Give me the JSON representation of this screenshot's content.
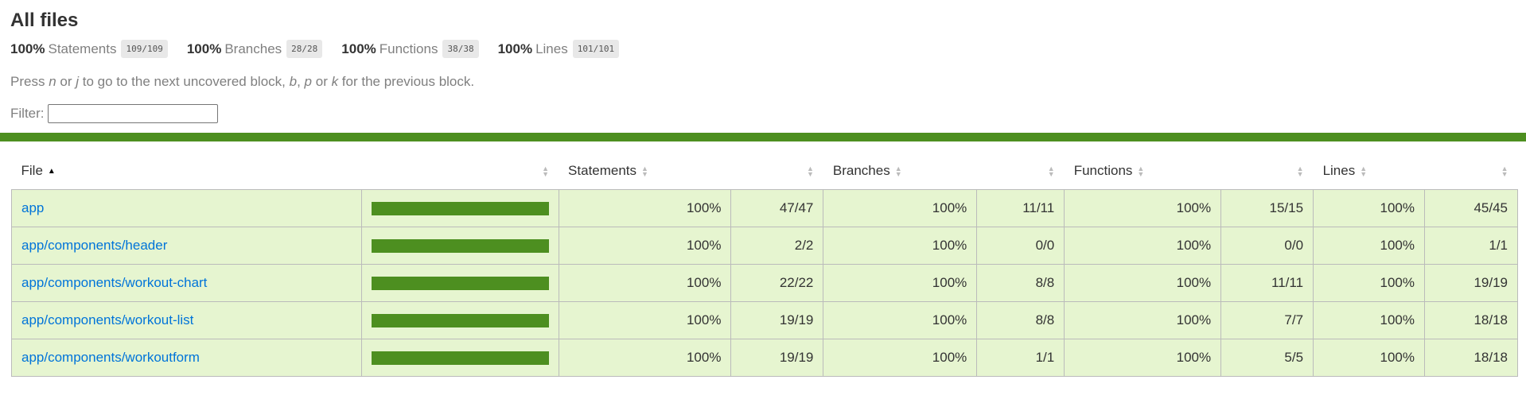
{
  "title": "All files",
  "summary": [
    {
      "pct": "100%",
      "label": "Statements",
      "fraction": "109/109"
    },
    {
      "pct": "100%",
      "label": "Branches",
      "fraction": "28/28"
    },
    {
      "pct": "100%",
      "label": "Functions",
      "fraction": "38/38"
    },
    {
      "pct": "100%",
      "label": "Lines",
      "fraction": "101/101"
    }
  ],
  "help": {
    "t1": "Press ",
    "k1": "n",
    "t2": " or ",
    "k2": "j",
    "t3": " to go to the next uncovered block, ",
    "k3": "b",
    "t4": ", ",
    "k4": "p",
    "t5": " or ",
    "k5": "k",
    "t6": " for the previous block."
  },
  "filter": {
    "label": "Filter:",
    "value": ""
  },
  "headers": {
    "file": "File",
    "statements": "Statements",
    "branches": "Branches",
    "functions": "Functions",
    "lines": "Lines"
  },
  "rows": [
    {
      "file": "app",
      "coverage": 100,
      "s_pct": "100%",
      "s": "47/47",
      "b_pct": "100%",
      "b": "11/11",
      "f_pct": "100%",
      "f": "15/15",
      "l_pct": "100%",
      "l": "45/45"
    },
    {
      "file": "app/components/header",
      "coverage": 100,
      "s_pct": "100%",
      "s": "2/2",
      "b_pct": "100%",
      "b": "0/0",
      "f_pct": "100%",
      "f": "0/0",
      "l_pct": "100%",
      "l": "1/1"
    },
    {
      "file": "app/components/workout-chart",
      "coverage": 100,
      "s_pct": "100%",
      "s": "22/22",
      "b_pct": "100%",
      "b": "8/8",
      "f_pct": "100%",
      "f": "11/11",
      "l_pct": "100%",
      "l": "19/19"
    },
    {
      "file": "app/components/workout-list",
      "coverage": 100,
      "s_pct": "100%",
      "s": "19/19",
      "b_pct": "100%",
      "b": "8/8",
      "f_pct": "100%",
      "f": "7/7",
      "l_pct": "100%",
      "l": "18/18"
    },
    {
      "file": "app/components/workoutform",
      "coverage": 100,
      "s_pct": "100%",
      "s": "19/19",
      "b_pct": "100%",
      "b": "1/1",
      "f_pct": "100%",
      "f": "5/5",
      "l_pct": "100%",
      "l": "18/18"
    }
  ],
  "colors": {
    "high": "#4d8f20",
    "high_bg": "#e6f5d0",
    "link": "#0074d9"
  }
}
